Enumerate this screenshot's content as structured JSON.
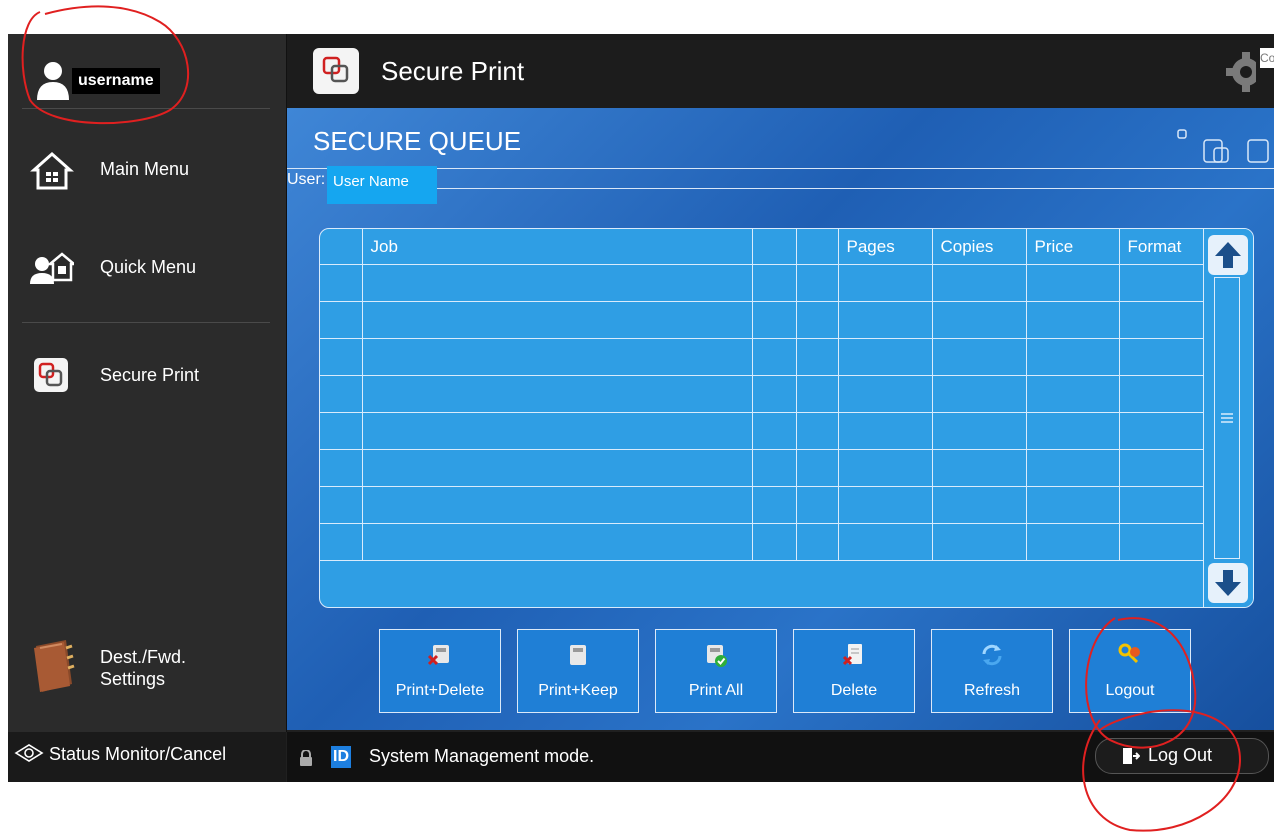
{
  "sidebar": {
    "username": "username",
    "items": [
      {
        "label": "Main Menu"
      },
      {
        "label": "Quick Menu"
      },
      {
        "label": "Secure Print"
      },
      {
        "label_line1": "Dest./Fwd.",
        "label_line2": "Settings"
      }
    ],
    "status_monitor": "Status Monitor/Cancel"
  },
  "header": {
    "title": "Secure Print",
    "corner_text": "Co"
  },
  "panel": {
    "title": "SECURE QUEUE",
    "user_label": "User:",
    "user_value": "User Name"
  },
  "table": {
    "columns": [
      "",
      "Job",
      "",
      "",
      "Pages",
      "Copies",
      "Price",
      "Format"
    ],
    "rows": [
      [
        "",
        "",
        "",
        "",
        "",
        "",
        "",
        ""
      ],
      [
        "",
        "",
        "",
        "",
        "",
        "",
        "",
        ""
      ],
      [
        "",
        "",
        "",
        "",
        "",
        "",
        "",
        ""
      ],
      [
        "",
        "",
        "",
        "",
        "",
        "",
        "",
        ""
      ],
      [
        "",
        "",
        "",
        "",
        "",
        "",
        "",
        ""
      ],
      [
        "",
        "",
        "",
        "",
        "",
        "",
        "",
        ""
      ],
      [
        "",
        "",
        "",
        "",
        "",
        "",
        "",
        ""
      ],
      [
        "",
        "",
        "",
        "",
        "",
        "",
        "",
        ""
      ]
    ]
  },
  "actions": [
    {
      "label": "Print+Delete",
      "icon": "print-delete-icon"
    },
    {
      "label": "Print+Keep",
      "icon": "print-keep-icon"
    },
    {
      "label": "Print All",
      "icon": "print-all-icon"
    },
    {
      "label": "Delete",
      "icon": "delete-icon"
    },
    {
      "label": "Refresh",
      "icon": "refresh-icon"
    },
    {
      "label": "Logout",
      "icon": "logout-keys-icon"
    }
  ],
  "statusbar": {
    "id_badge": "ID",
    "mode_text": "System Management mode.",
    "logout_label": "Log Out"
  },
  "colors": {
    "panel_blue": "#2a73c8",
    "table_blue": "#2f9ee4",
    "user_field": "#15a6f0",
    "annotation_red": "#e02020"
  }
}
